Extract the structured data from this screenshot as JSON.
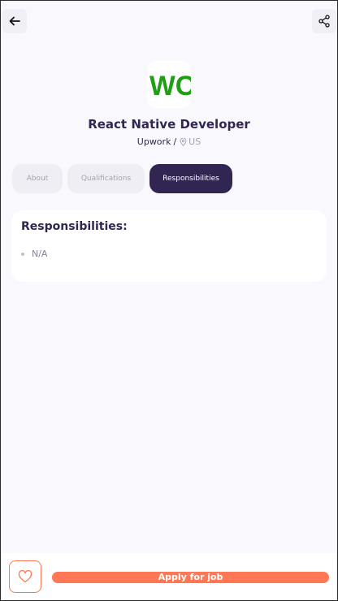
{
  "header": {
    "back_icon": "arrow-left-icon",
    "share_icon": "share-icon"
  },
  "job": {
    "logo_text": "WC",
    "title": "React Native Developer",
    "company": "Upwork",
    "separator": "/",
    "location": "US",
    "location_icon": "location-pin-icon"
  },
  "tabs": [
    {
      "label": "About",
      "active": false
    },
    {
      "label": "Qualifications",
      "active": false
    },
    {
      "label": "Responsibilities",
      "active": true
    }
  ],
  "section": {
    "title": "Responsibilities:",
    "points": [
      "N/A"
    ]
  },
  "footer": {
    "like_icon": "heart-icon",
    "apply_label": "Apply for job"
  },
  "colors": {
    "primary": "#312651",
    "accent": "#ff7754",
    "logo_green": "#1f9e16",
    "background": "#f9f9fd"
  }
}
